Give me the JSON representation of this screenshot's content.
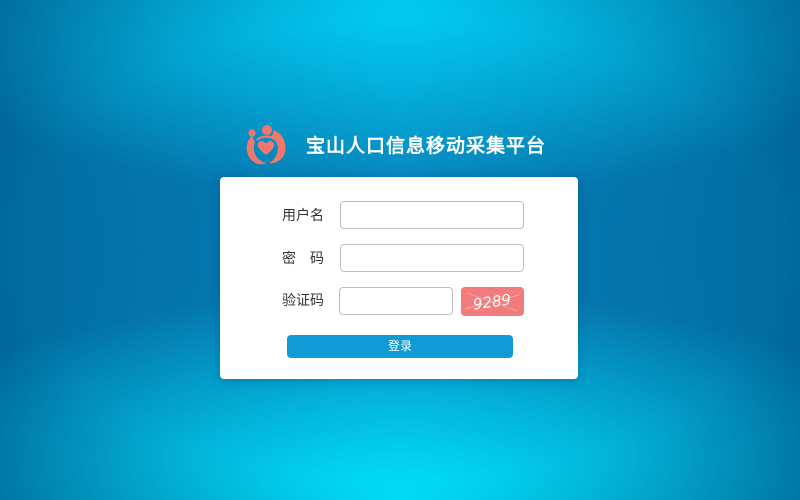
{
  "brand": {
    "title": "宝山人口信息移动采集平台",
    "logo_icon": "family-heart-logo",
    "logo_color": "#f0776e"
  },
  "login_form": {
    "username_label": "用户名",
    "username_value": "",
    "password_label": "密码",
    "password_value": "",
    "captcha_label": "验证码",
    "captcha_value": "",
    "captcha_text": "9289",
    "captcha_bg_color": "#f27b7b",
    "submit_label": "登录",
    "submit_color": "#109ad6"
  }
}
